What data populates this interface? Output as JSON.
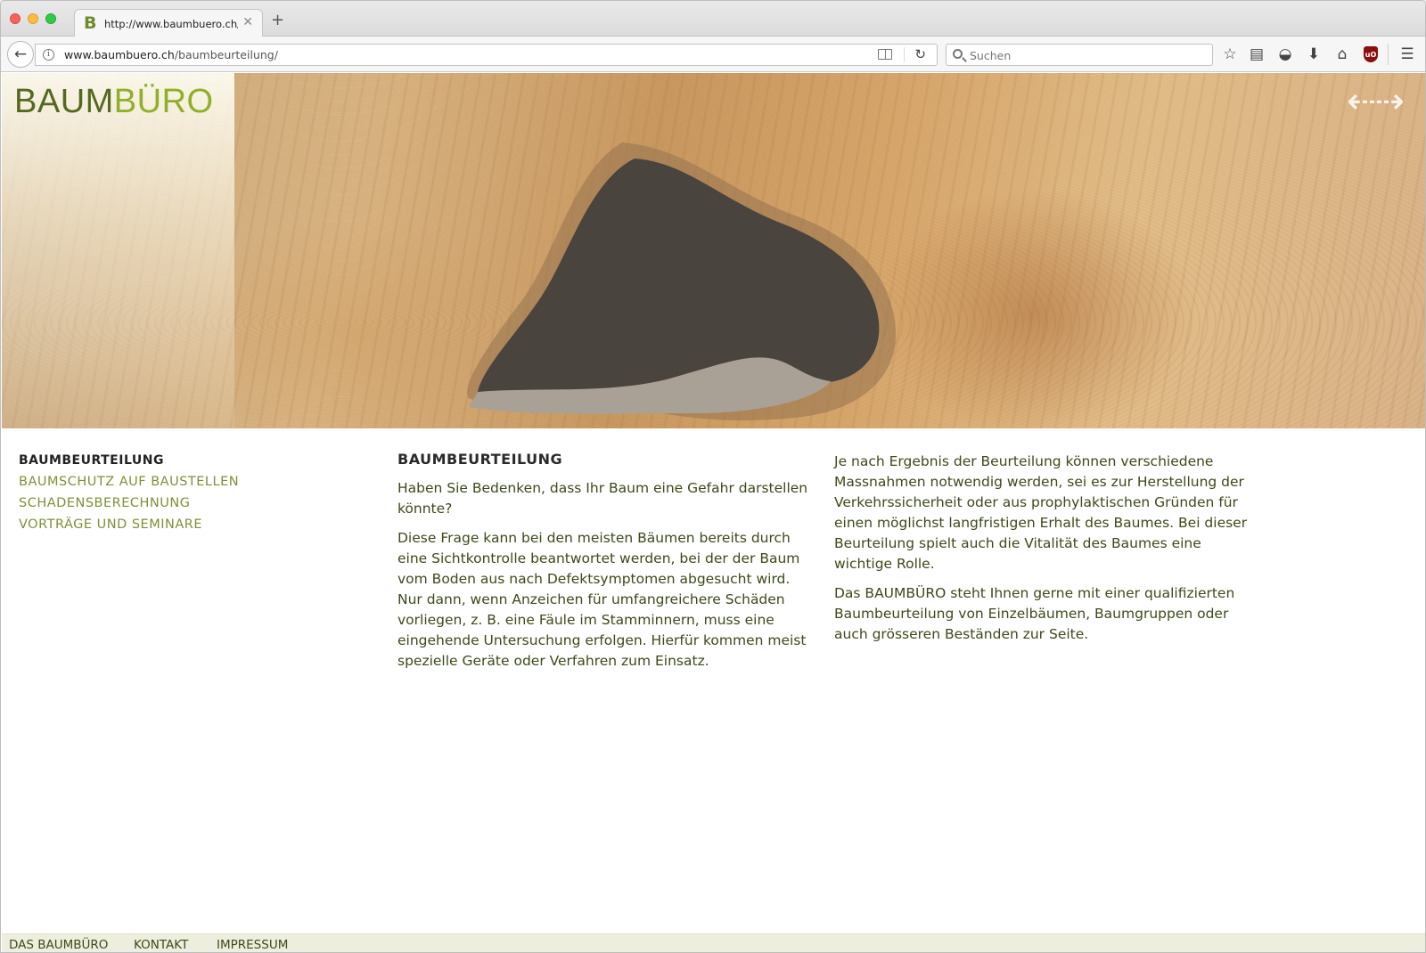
{
  "browser": {
    "tab_title": "http://www.baumbuero.ch/baumbeurteilung/",
    "tab_favicon": "B",
    "url_host": "www.baumbuero.ch",
    "url_path": "/baumbeurteilung/",
    "search_placeholder": "Suchen",
    "icons": [
      "back-arrow-icon",
      "info-icon",
      "reader-view-icon",
      "reload-icon",
      "search-icon",
      "bookmark-star-icon",
      "reading-list-icon",
      "pocket-icon",
      "download-icon",
      "home-icon",
      "ublock-icon",
      "hamburger-menu-icon"
    ],
    "ublock_label": "uO"
  },
  "site": {
    "logo_part1": "BAUM",
    "logo_part2": "BÜRO",
    "brand_colors": {
      "dark_green": "#55691e",
      "light_green": "#8fb028",
      "text_green": "#3c4a18",
      "nav_green": "#7e9138"
    }
  },
  "subnav": {
    "items": [
      {
        "label": "BAUMBEURTEILUNG",
        "active": true
      },
      {
        "label": "BAUMSCHUTZ AUF BAUSTELLEN",
        "active": false
      },
      {
        "label": "SCHADENSBERECHNUNG",
        "active": false
      },
      {
        "label": "VORTRÄGE UND SEMINARE",
        "active": false
      }
    ]
  },
  "content": {
    "heading": "BAUMBEURTEILUNG",
    "col1": [
      "Haben Sie Bedenken, dass Ihr Baum eine Gefahr darstellen könnte?",
      "Diese Frage kann bei den meisten Bäumen bereits durch eine Sichtkontrolle beantwortet werden, bei der der Baum vom Boden aus nach Defektsymptomen abgesucht wird. Nur dann, wenn Anzeichen für umfangreichere Schäden vorliegen, z. B. eine Fäule im Stamminnern, muss eine eingehende Untersuchung erfolgen. Hierfür kommen meist spezielle Geräte oder Verfahren zum Einsatz."
    ],
    "col2": [
      "Je nach Ergebnis der Beurteilung können verschiedene Massnahmen notwendig werden, sei es zur Herstellung der Verkehrssicherheit oder aus prophylaktischen Gründen für einen möglichst langfristigen Erhalt des Baumes. Bei dieser Beurteilung spielt auch die Vitalität des Baumes eine wichtige Rolle.",
      "Das BAUMBÜRO steht Ihnen gerne mit einer qualifizierten Baumbeurteilung von Einzelbäumen, Baumgruppen oder auch grösseren Beständen zur Seite."
    ]
  },
  "footer": {
    "links": [
      "DAS BAUMBÜRO",
      "KONTAKT",
      "IMPRESSUM"
    ]
  }
}
